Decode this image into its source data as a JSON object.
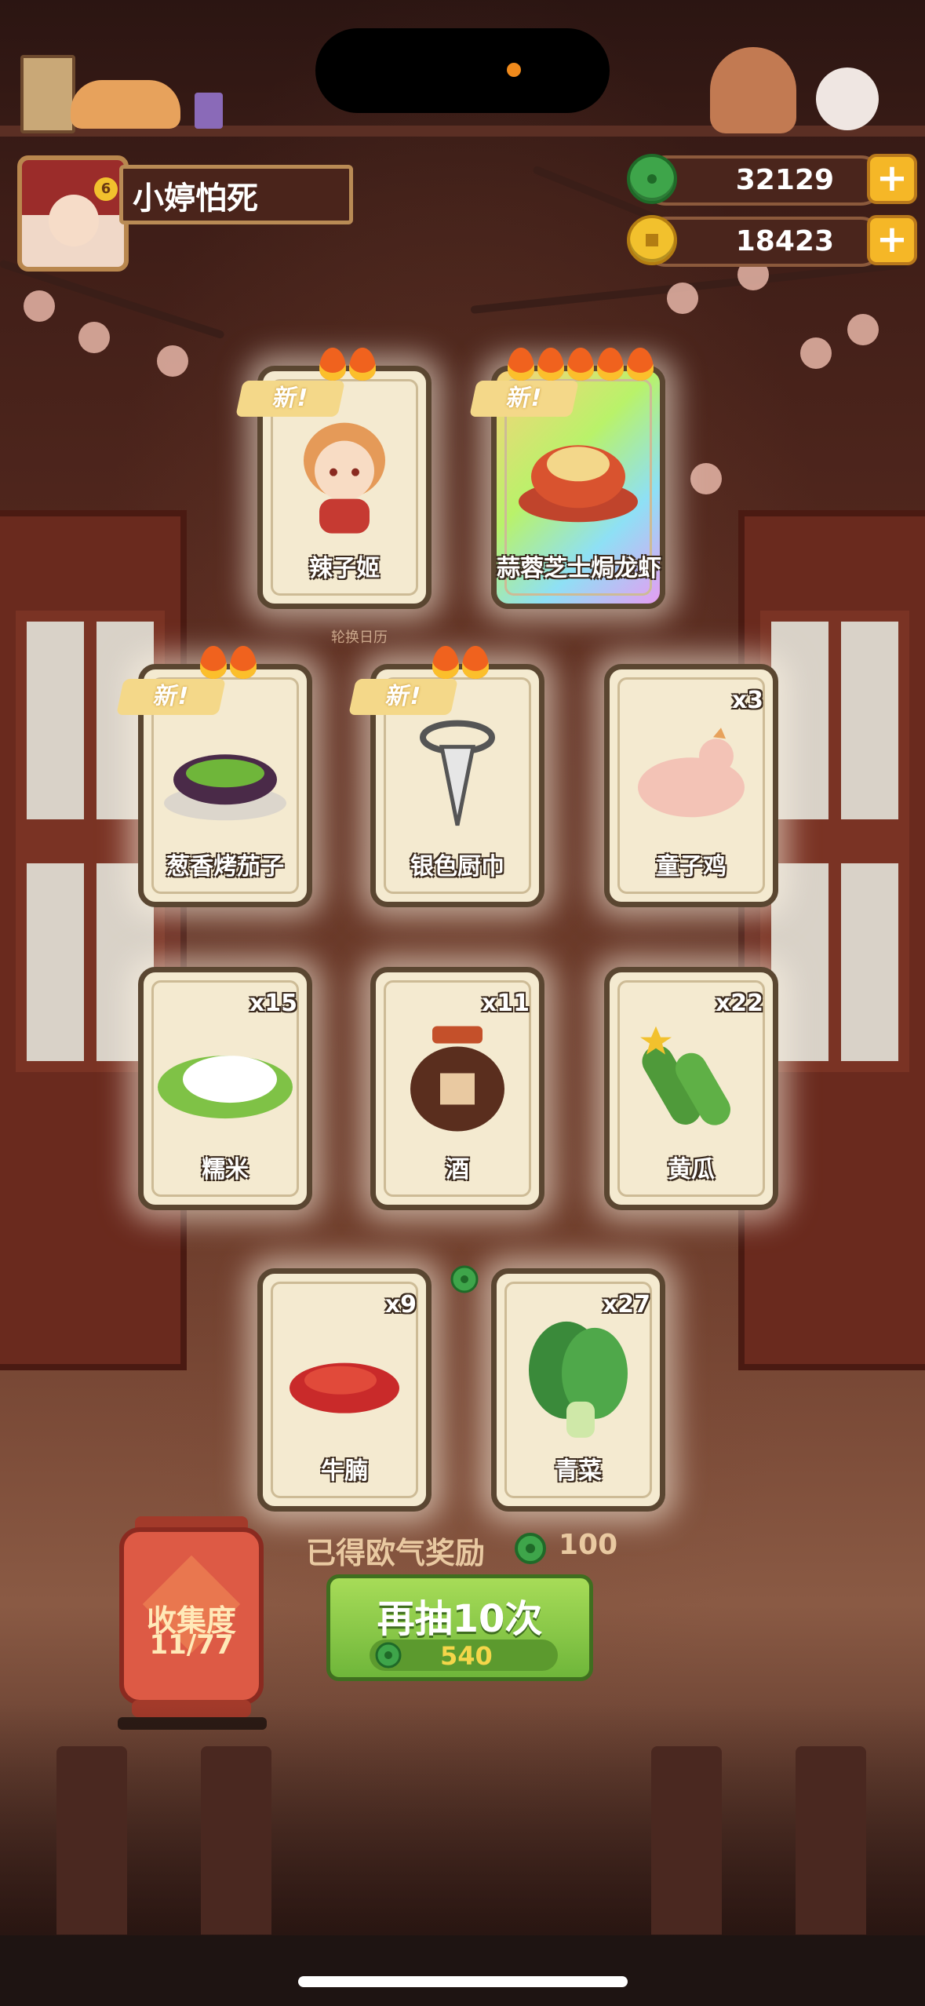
{
  "player": {
    "name": "小婷怕死",
    "level": "6"
  },
  "currency": {
    "jade": "32129",
    "coins": "18423",
    "plus": "+"
  },
  "cards": [
    {
      "label": "辣子姬",
      "new": "新!",
      "flames": 2,
      "count": ""
    },
    {
      "label": "蒜蓉芝士焗龙虾",
      "new": "新!",
      "flames": 5,
      "count": ""
    },
    {
      "label": "葱香烤茄子",
      "new": "新!",
      "flames": 2,
      "count": ""
    },
    {
      "label": "银色厨巾",
      "new": "新!",
      "flames": 2,
      "count": ""
    },
    {
      "label": "童子鸡",
      "new": "",
      "flames": 0,
      "count": "x3"
    },
    {
      "label": "糯米",
      "new": "",
      "flames": 0,
      "count": "x15"
    },
    {
      "label": "酒",
      "new": "",
      "flames": 0,
      "count": "x11"
    },
    {
      "label": "黄瓜",
      "new": "",
      "flames": 0,
      "count": "x22"
    },
    {
      "label": "牛腩",
      "new": "",
      "flames": 0,
      "count": "x9"
    },
    {
      "label": "青菜",
      "new": "",
      "flames": 0,
      "count": "x27"
    }
  ],
  "calendar_text": "轮换日历",
  "reward": {
    "label": "已得欧气奖励",
    "value": "100"
  },
  "draw_button": {
    "label": "再抽10次",
    "cost": "540"
  },
  "collection": {
    "label": "收集度",
    "progress": "11/77"
  },
  "colors": {
    "jade": "#3ea54a",
    "coin": "#f2c12d",
    "button": "#7fc246",
    "lantern": "#dd5a45"
  }
}
